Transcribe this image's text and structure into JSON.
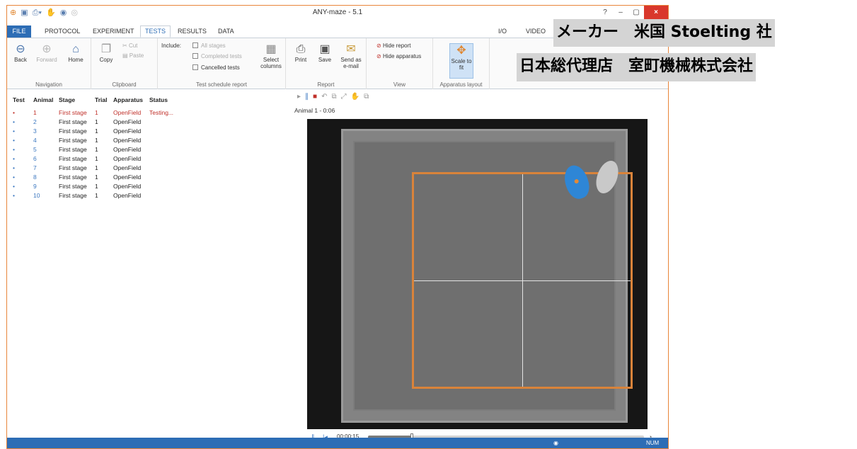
{
  "app": {
    "title": "ANY-maze - 5.1"
  },
  "window_controls": {
    "help": "?",
    "minimize": "–",
    "maximize": "▢",
    "close": "×"
  },
  "tabs": [
    "FILE",
    "PROTOCOL",
    "EXPERIMENT",
    "TESTS",
    "RESULTS",
    "DATA"
  ],
  "right_tabs": [
    "I/O",
    "VIDEO"
  ],
  "active_tab": "TESTS",
  "ribbon": {
    "navigation": {
      "label": "Navigation",
      "back": "Back",
      "forward": "Forward",
      "home": "Home"
    },
    "clipboard": {
      "label": "Clipboard",
      "copy": "Copy",
      "cut": "Cut",
      "paste": "Paste"
    },
    "schedule": {
      "label": "Test schedule report",
      "include": "Include:",
      "all_stages": "All stages",
      "completed_tests": "Completed tests",
      "cancelled_tests": "Cancelled tests",
      "select_columns": "Select columns"
    },
    "report": {
      "label": "Report",
      "print": "Print",
      "save": "Save",
      "send": "Send as e-mail"
    },
    "view": {
      "label": "View",
      "hide_report": "Hide report",
      "hide_apparatus": "Hide apparatus"
    },
    "layout": {
      "label": "Apparatus layout",
      "scale": "Scale to fit"
    }
  },
  "table": {
    "headers": [
      "Test",
      "Animal",
      "Stage",
      "Trial",
      "Apparatus",
      "Status"
    ],
    "rows": [
      {
        "test": "•",
        "animal": "1",
        "stage": "First stage",
        "trial": "1",
        "apparatus": "OpenField",
        "status": "Testing..."
      },
      {
        "test": "•",
        "animal": "2",
        "stage": "First stage",
        "trial": "1",
        "apparatus": "OpenField",
        "status": ""
      },
      {
        "test": "•",
        "animal": "3",
        "stage": "First stage",
        "trial": "1",
        "apparatus": "OpenField",
        "status": ""
      },
      {
        "test": "•",
        "animal": "4",
        "stage": "First stage",
        "trial": "1",
        "apparatus": "OpenField",
        "status": ""
      },
      {
        "test": "•",
        "animal": "5",
        "stage": "First stage",
        "trial": "1",
        "apparatus": "OpenField",
        "status": ""
      },
      {
        "test": "•",
        "animal": "6",
        "stage": "First stage",
        "trial": "1",
        "apparatus": "OpenField",
        "status": ""
      },
      {
        "test": "•",
        "animal": "7",
        "stage": "First stage",
        "trial": "1",
        "apparatus": "OpenField",
        "status": ""
      },
      {
        "test": "•",
        "animal": "8",
        "stage": "First stage",
        "trial": "1",
        "apparatus": "OpenField",
        "status": ""
      },
      {
        "test": "•",
        "animal": "9",
        "stage": "First stage",
        "trial": "1",
        "apparatus": "OpenField",
        "status": ""
      },
      {
        "test": "•",
        "animal": "10",
        "stage": "First stage",
        "trial": "1",
        "apparatus": "OpenField",
        "status": ""
      }
    ]
  },
  "video": {
    "animal_time": "Animal 1 - 0:06",
    "elapsed": "00:00:15",
    "progress_fraction": 0.16
  },
  "statusbar": {
    "num": "NUM"
  },
  "banners": {
    "maker": "メーカー　米国 Stoelting 社",
    "agent": "日本総代理店　室町機械株式会社"
  },
  "colors": {
    "accent": "#2d6db5",
    "tracking_zone": "#d9833a",
    "animal": "#2e86d6",
    "testing": "#c0302a"
  }
}
